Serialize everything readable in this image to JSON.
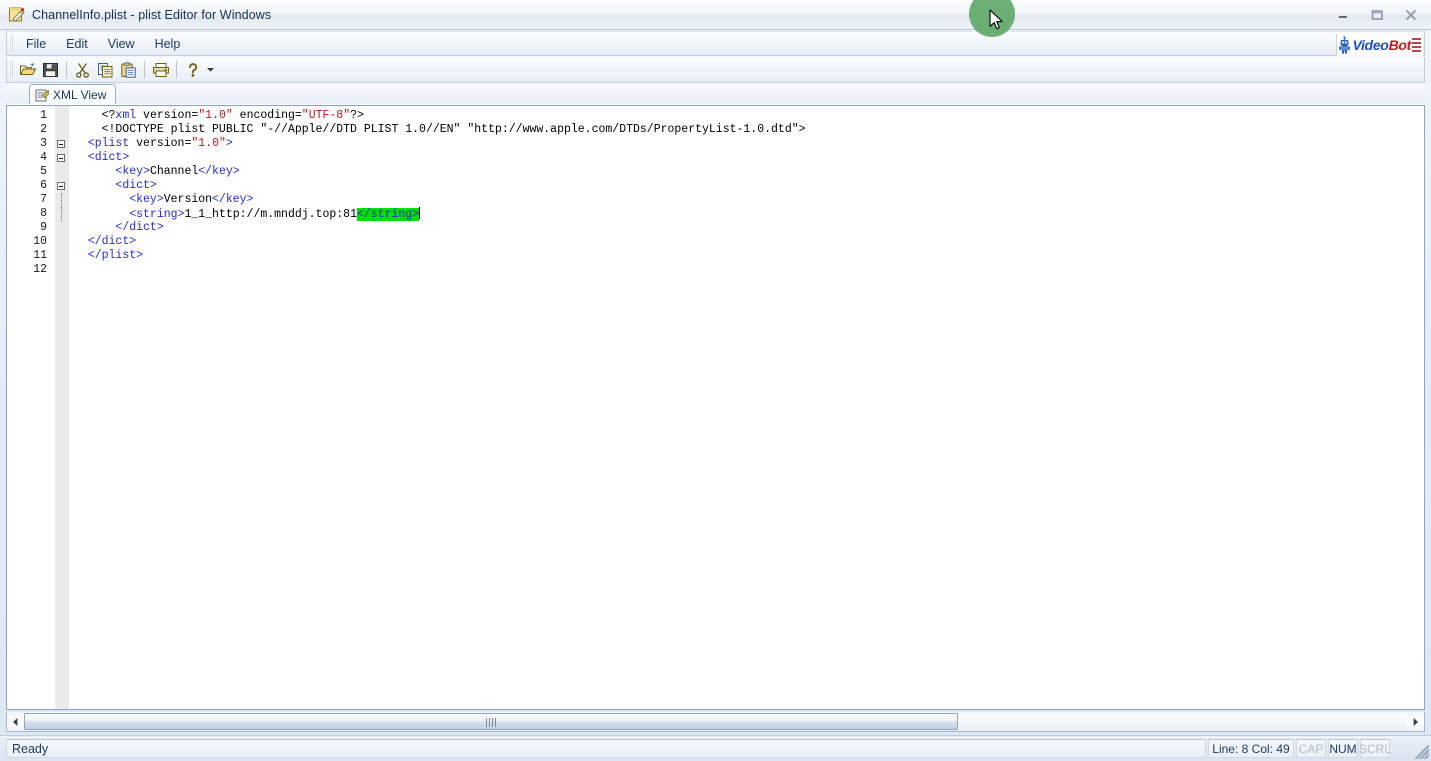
{
  "window": {
    "title": "ChannelInfo.plist - plist Editor for Windows",
    "icon": "notepad-pencil-icon",
    "buttons": {
      "minimize": "minimize-icon",
      "maximize": "maximize-icon",
      "close": "close-icon"
    }
  },
  "menubar": {
    "items": [
      {
        "label": "File"
      },
      {
        "label": "Edit"
      },
      {
        "label": "View"
      },
      {
        "label": "Help"
      }
    ],
    "logo": {
      "part1": "Video",
      "part2": "Bot"
    }
  },
  "toolbar": {
    "buttons": [
      {
        "name": "open-button",
        "icon": "open-folder-icon"
      },
      {
        "name": "save-button",
        "icon": "floppy-disk-icon"
      },
      {
        "name": "cut-button",
        "icon": "scissors-icon"
      },
      {
        "name": "copy-button",
        "icon": "copy-icon"
      },
      {
        "name": "paste-button",
        "icon": "clipboard-paste-icon"
      },
      {
        "name": "print-button",
        "icon": "printer-icon"
      },
      {
        "name": "help-button",
        "icon": "question-mark-icon"
      },
      {
        "name": "toolbar-overflow-button",
        "icon": "chevron-down-icon"
      }
    ]
  },
  "tabs": [
    {
      "label": "XML View",
      "icon": "xml-document-icon",
      "active": true
    }
  ],
  "editor": {
    "lines": [
      {
        "num": "1",
        "fold": "none",
        "tokens": [
          {
            "t": "    <?",
            "c": "black"
          },
          {
            "t": "xml",
            "c": "name"
          },
          {
            "t": " version=",
            "c": "black"
          },
          {
            "t": "\"1.0\"",
            "c": "str"
          },
          {
            "t": " encoding=",
            "c": "black"
          },
          {
            "t": "\"UTF-8\"",
            "c": "str"
          },
          {
            "t": "?>",
            "c": "black"
          }
        ]
      },
      {
        "num": "2",
        "fold": "none",
        "tokens": [
          {
            "t": "    <!DOCTYPE plist PUBLIC \"-//Apple//DTD PLIST 1.0//EN\" \"http://www.apple.com/DTDs/PropertyList-1.0.dtd\">",
            "c": "black"
          }
        ]
      },
      {
        "num": "3",
        "fold": "box",
        "tokens": [
          {
            "t": "  ",
            "c": "black"
          },
          {
            "t": "<plist",
            "c": "tag"
          },
          {
            "t": " version=",
            "c": "black"
          },
          {
            "t": "\"1.0\"",
            "c": "str"
          },
          {
            "t": ">",
            "c": "tag"
          }
        ]
      },
      {
        "num": "4",
        "fold": "box",
        "tokens": [
          {
            "t": "  ",
            "c": "black"
          },
          {
            "t": "<dict>",
            "c": "tag"
          }
        ]
      },
      {
        "num": "5",
        "fold": "none",
        "tokens": [
          {
            "t": "      ",
            "c": "black"
          },
          {
            "t": "<key>",
            "c": "tag"
          },
          {
            "t": "Channel",
            "c": "black"
          },
          {
            "t": "</key>",
            "c": "tag"
          }
        ]
      },
      {
        "num": "6",
        "fold": "box",
        "tokens": [
          {
            "t": "      ",
            "c": "black"
          },
          {
            "t": "<dict>",
            "c": "tag"
          }
        ]
      },
      {
        "num": "7",
        "fold": "line",
        "tokens": [
          {
            "t": "        ",
            "c": "black"
          },
          {
            "t": "<key>",
            "c": "tag"
          },
          {
            "t": "Version",
            "c": "black"
          },
          {
            "t": "</key>",
            "c": "tag"
          }
        ]
      },
      {
        "num": "8",
        "fold": "line",
        "tokens": [
          {
            "t": "        ",
            "c": "black"
          },
          {
            "t": "<string>",
            "c": "tag"
          },
          {
            "t": "1_1_http://m.mnddj.top:81",
            "c": "black"
          },
          {
            "t": "</string>",
            "c": "sel"
          },
          {
            "t": "",
            "c": "caret"
          }
        ]
      },
      {
        "num": "9",
        "fold": "none",
        "tokens": [
          {
            "t": "      ",
            "c": "black"
          },
          {
            "t": "</dict>",
            "c": "tag"
          }
        ]
      },
      {
        "num": "10",
        "fold": "none",
        "tokens": [
          {
            "t": "  ",
            "c": "black"
          },
          {
            "t": "</dict>",
            "c": "tag"
          }
        ]
      },
      {
        "num": "11",
        "fold": "none",
        "tokens": [
          {
            "t": "  ",
            "c": "black"
          },
          {
            "t": "</plist>",
            "c": "tag"
          }
        ]
      },
      {
        "num": "12",
        "fold": "none",
        "tokens": []
      }
    ],
    "selection_text": "</string>",
    "selection_color": "#00e000"
  },
  "statusbar": {
    "message": "Ready",
    "position": "Line: 8 Col: 49",
    "indicators": [
      {
        "label": "CAP",
        "active": false
      },
      {
        "label": "NUM",
        "active": true
      },
      {
        "label": "SCRL",
        "active": false
      }
    ]
  },
  "scrollbar": {
    "left_arrow": "left-arrow-icon",
    "right_arrow": "right-arrow-icon"
  }
}
